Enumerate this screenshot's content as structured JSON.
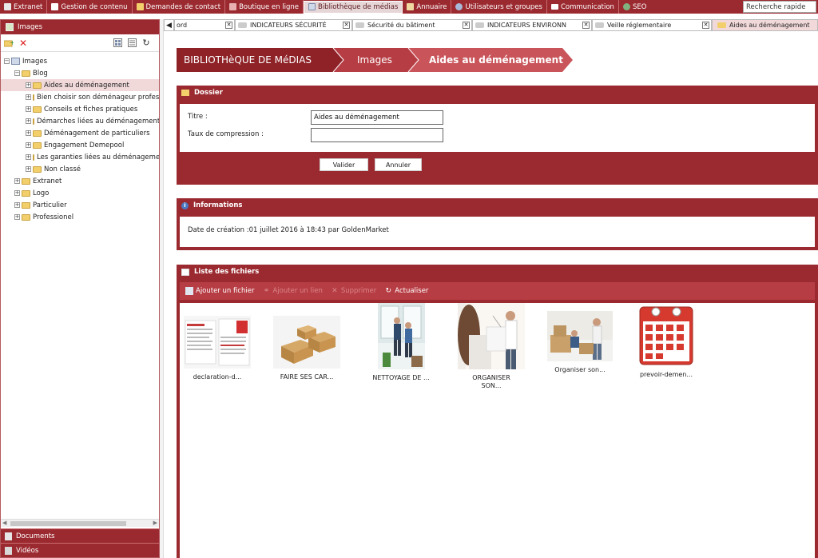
{
  "topbar": {
    "items": [
      {
        "label": "Extranet",
        "color": "#e8e8e8"
      },
      {
        "label": "Gestion de contenu",
        "color": "#ffffff"
      },
      {
        "label": "Demandes de contact",
        "color": "#f2cf6b"
      },
      {
        "label": "Boutique en ligne",
        "color": "#e8b0b0"
      },
      {
        "label": "Bibliothèque de médias",
        "color": "#cfd9ea"
      },
      {
        "label": "Annuaire",
        "color": "#f0d9a0"
      },
      {
        "label": "Utilisateurs et groupes",
        "color": "#a8b8d8"
      },
      {
        "label": "Communication",
        "color": "#ffffff"
      },
      {
        "label": "SEO",
        "color": "#7fb27f"
      }
    ],
    "search_value": "Recherche rapide"
  },
  "left_panel": {
    "title": "Images",
    "tree": [
      {
        "label": "Images",
        "exp": "−"
      },
      {
        "label": "Blog",
        "exp": "−"
      },
      {
        "label": "Aides au déménagement",
        "exp": "+"
      },
      {
        "label": "Bien choisir son déménageur professionnel",
        "exp": "+"
      },
      {
        "label": "Conseils et fiches pratiques",
        "exp": "+"
      },
      {
        "label": "Démarches liées au déménagement",
        "exp": "+"
      },
      {
        "label": "Déménagement de particuliers",
        "exp": "+"
      },
      {
        "label": "Engagement Demepool",
        "exp": "+"
      },
      {
        "label": "Les garanties liées au déménagement",
        "exp": "+"
      },
      {
        "label": "Non classé",
        "exp": "+"
      },
      {
        "label": "Extranet",
        "exp": "+"
      },
      {
        "label": "Logo",
        "exp": "+"
      },
      {
        "label": "Particulier",
        "exp": "+"
      },
      {
        "label": "Professionel",
        "exp": "+"
      }
    ],
    "bottom": [
      "Documents",
      "Vidéos"
    ]
  },
  "tabs": [
    {
      "label": "ord"
    },
    {
      "label": "INDICATEURS SÉCURITÉ"
    },
    {
      "label": "Sécurité du bâtiment"
    },
    {
      "label": "INDICATEURS ENVIRONN"
    },
    {
      "label": "Veille réglementaire"
    },
    {
      "label": "Aides au déménagement"
    }
  ],
  "breadcrumb": [
    "BIBLIOTHèQUE DE MéDIAS",
    "Images",
    "Aides au déménagement"
  ],
  "dossier": {
    "title": "Dossier",
    "titre_label": "Titre :",
    "titre_value": "Aides au déménagement",
    "compression_label": "Taux de compression :",
    "compression_value": "",
    "valider": "Valider",
    "annuler": "Annuler"
  },
  "informations": {
    "title": "Informations",
    "text": "Date de création :01 juillet 2016 à 18:43 par GoldenMarket"
  },
  "files": {
    "title": "Liste des fichiers",
    "toolbar": [
      "Ajouter un fichier",
      "Ajouter un lien",
      "Supprimer",
      "Actualiser"
    ],
    "items": [
      {
        "name": "declaration-d..."
      },
      {
        "name": "FAIRE SES CAR..."
      },
      {
        "name": "NETTOYAGE DE ..."
      },
      {
        "name": "ORGANISER SON..."
      },
      {
        "name": "Organiser son..."
      },
      {
        "name": "prevoir-demen..."
      }
    ]
  },
  "colors": {
    "brand": "#9b2a30",
    "accent": "#b73d44",
    "highlight": "#f1d9da"
  }
}
